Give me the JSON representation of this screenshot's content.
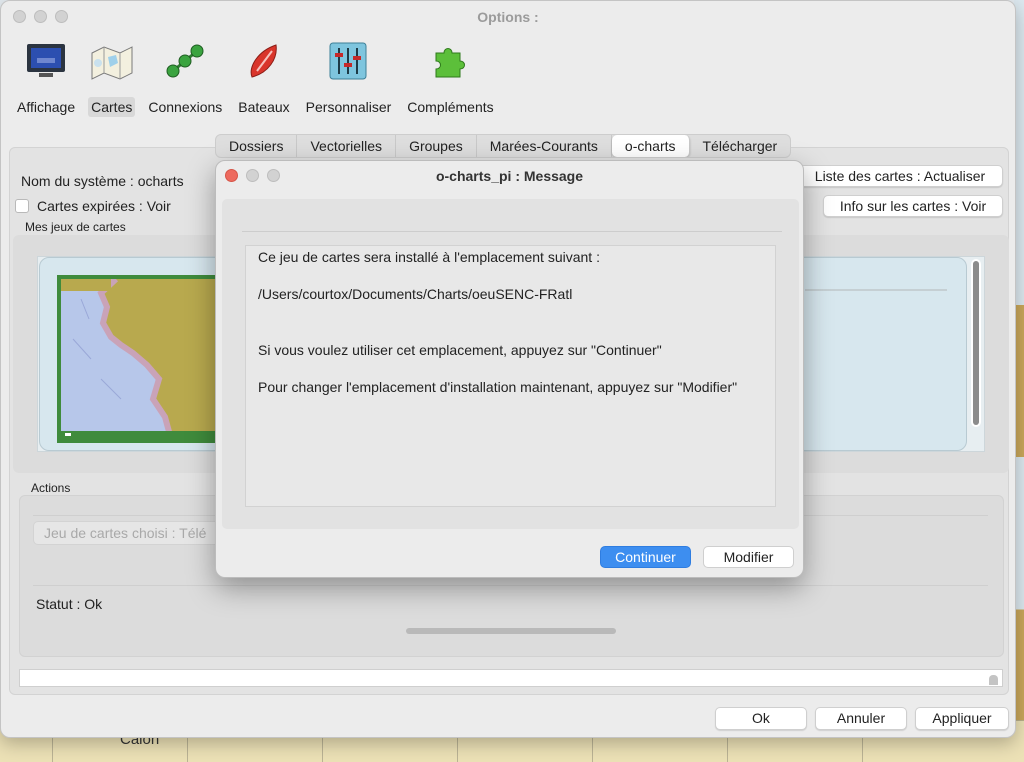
{
  "background": {
    "caption": "Calon"
  },
  "window": {
    "title": "Options :"
  },
  "toolbar": {
    "items": [
      {
        "label": "Affichage",
        "icon": "monitor-icon"
      },
      {
        "label": "Cartes",
        "icon": "charts-icon",
        "active": true
      },
      {
        "label": "Connexions",
        "icon": "connections-icon"
      },
      {
        "label": "Bateaux",
        "icon": "boat-icon"
      },
      {
        "label": "Personnaliser",
        "icon": "sliders-icon"
      },
      {
        "label": "Compléments",
        "icon": "puzzle-icon"
      }
    ]
  },
  "tabs": [
    {
      "label": "Dossiers"
    },
    {
      "label": "Vectorielles"
    },
    {
      "label": "Groupes"
    },
    {
      "label": "Marées-Courants"
    },
    {
      "label": "o-charts",
      "active": true
    },
    {
      "label": "Télécharger"
    }
  ],
  "ocharts": {
    "system_name": "Nom du système : ocharts",
    "expired_label": "Cartes expirées : Voir",
    "refresh_button": "Liste des cartes : Actualiser",
    "info_button": "Info sur les cartes : Voir",
    "chartsets_label": "Mes jeux de cartes",
    "actions_label": "Actions",
    "chosen_set_button": "Jeu de cartes choisi : Télé",
    "status": "Statut : Ok"
  },
  "footer": {
    "ok": "Ok",
    "cancel": "Annuler",
    "apply": "Appliquer"
  },
  "dialog": {
    "title": "o-charts_pi : Message",
    "lines": [
      "Ce jeu de cartes sera installé à l'emplacement suivant :",
      "/Users/courtox/Documents/Charts/oeuSENC-FRatl",
      "Si vous voulez utiliser cet emplacement, appuyez sur \"Continuer\"",
      "Pour changer l'emplacement d'installation maintenant, appuyez sur \"Modifier\""
    ],
    "continue_button": "Continuer",
    "modify_button": "Modifier"
  },
  "colors": {
    "accent": "#3d8ef0",
    "close": "#ed6a5e",
    "chart_border": "#3f8b3c"
  }
}
